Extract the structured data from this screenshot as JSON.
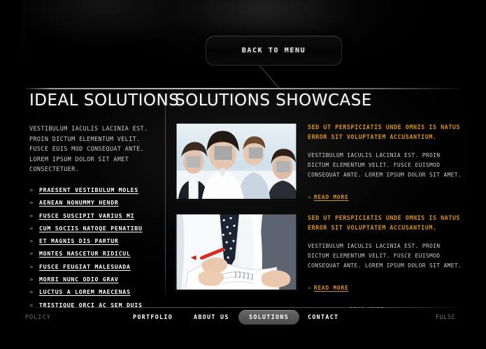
{
  "theme": {
    "background": "#000000",
    "accent": "#d8901f",
    "text": "#c9c9c9",
    "heading": "#ffffff",
    "active_pill": "#565656"
  },
  "header": {
    "back_button_label": "BACK TO MENU"
  },
  "left_column": {
    "title": "IDEAL SOLUTIONS",
    "intro": "VESTIBULUM IACULIS LACINIA EST. PROIN DICTUM ELEMENTUM VELIT. FUSCE EUIS MOD CONSEQUAT ANTE. LOREM IPSUM DOLOR SIT AMET CONSECTETUER.",
    "bullet_glyph": "»",
    "links": [
      {
        "label": "PRAESENT VESTIBULUM MOLES"
      },
      {
        "label": "AENEAN NONUMMY HENDR"
      },
      {
        "label": "FUSCE SUSCIPIT VARIUS MI"
      },
      {
        "label": "CUM SOCIIS NATOQE PENATIBU"
      },
      {
        "label": "ET MAGNIS DIS PARTUR"
      },
      {
        "label": "MONTES NASCETUR RIDICUL"
      },
      {
        "label": "FUSCE FEUGIAT MALESUADA"
      },
      {
        "label": "MORBI NUNC ODIO GRAV"
      },
      {
        "label": "LUCTUS A LOREM MAECENAS"
      },
      {
        "label": "TRISTIQUE ORCI AC SEM DUIS"
      }
    ]
  },
  "right_column": {
    "title": "SOLUTIONS SHOWCASE",
    "read_more_label": "READ MORE",
    "bullet_glyph": "»",
    "articles": [
      {
        "image_name": "business-team-photo",
        "title": "SED UT PERSPICIATIS UNDE OMNIS IS NATUS ERROR SIT VOLUPTATEM ACCUSANTIUM.",
        "body": "VESTIBULUM IACULIS LACINIA EST. PROIN DICTUM ELEMENTUM VELIT. FUSCE EUISMOD CONSEQUAT ANTE. LOREM IPSUM DOLOR SIT AMET.",
        "read_more": "READ MORE"
      },
      {
        "image_name": "document-review-photo",
        "title": "SED UT PERSPICIATIS UNDE OMNIS IS NATUS ERROR SIT VOLUPTATEM ACCUSANTIUM.",
        "body": "VESTIBULUM IACULIS LACINIA EST. PROIN DICTUM ELEMENTUM VELIT. FUSCE EUISMOD CONSEQUAT ANTE. LOREM IPSUM DOLOR SIT AMET.",
        "read_more": "READ MORE"
      }
    ],
    "clipped_read_more": "READ MORE"
  },
  "bottom_nav": {
    "items": [
      {
        "label": "POLICY",
        "state": "muted"
      },
      {
        "label": "PORTFOLIO",
        "state": "normal"
      },
      {
        "label": "ABOUT US",
        "state": "normal"
      },
      {
        "label": "SOLUTIONS",
        "state": "active"
      },
      {
        "label": "CONTACT",
        "state": "normal"
      }
    ],
    "clipped_label": "Fulsc"
  }
}
